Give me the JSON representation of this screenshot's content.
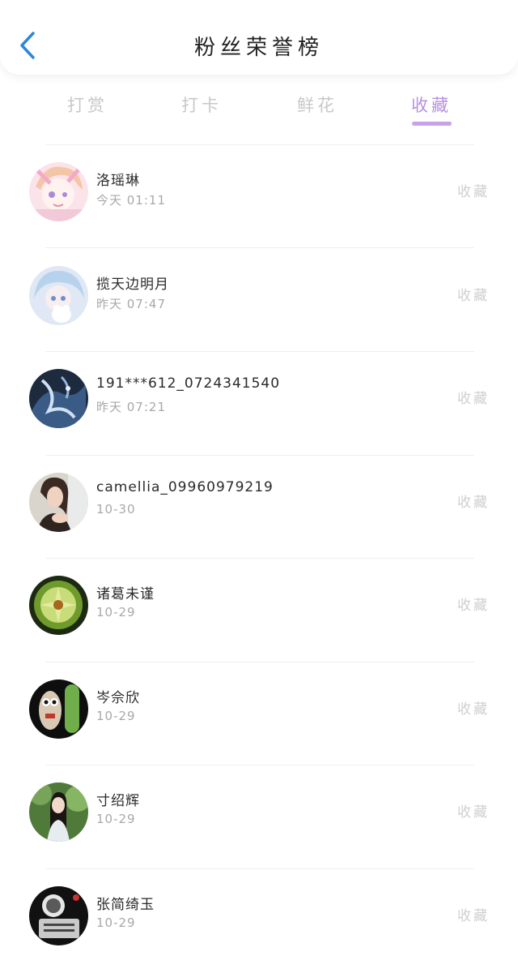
{
  "header": {
    "title": "粉丝荣誉榜"
  },
  "tabs": [
    {
      "label": "打赏"
    },
    {
      "label": "打卡"
    },
    {
      "label": "鲜花"
    },
    {
      "label": "收藏"
    }
  ],
  "active_tab": "收藏",
  "colors": {
    "accent": "#c7a1ea",
    "back_icon": "#2f86d8"
  },
  "fans": [
    {
      "name": "洛瑶琳",
      "time": "今天 01:11",
      "action": "收藏"
    },
    {
      "name": "揽天边明月",
      "time": "昨天 07:47",
      "action": "收藏"
    },
    {
      "name": "191***612_0724341540",
      "time": "昨天 07:21",
      "action": "收藏"
    },
    {
      "name": "camellia_09960979219",
      "time": "10-30",
      "action": "收藏"
    },
    {
      "name": "诸葛未谨",
      "time": "10-29",
      "action": "收藏"
    },
    {
      "name": "岑佘欣",
      "time": "10-29",
      "action": "收藏"
    },
    {
      "name": "寸绍辉",
      "time": "10-29",
      "action": "收藏"
    },
    {
      "name": "张简绮玉",
      "time": "10-29",
      "action": "收藏"
    }
  ]
}
